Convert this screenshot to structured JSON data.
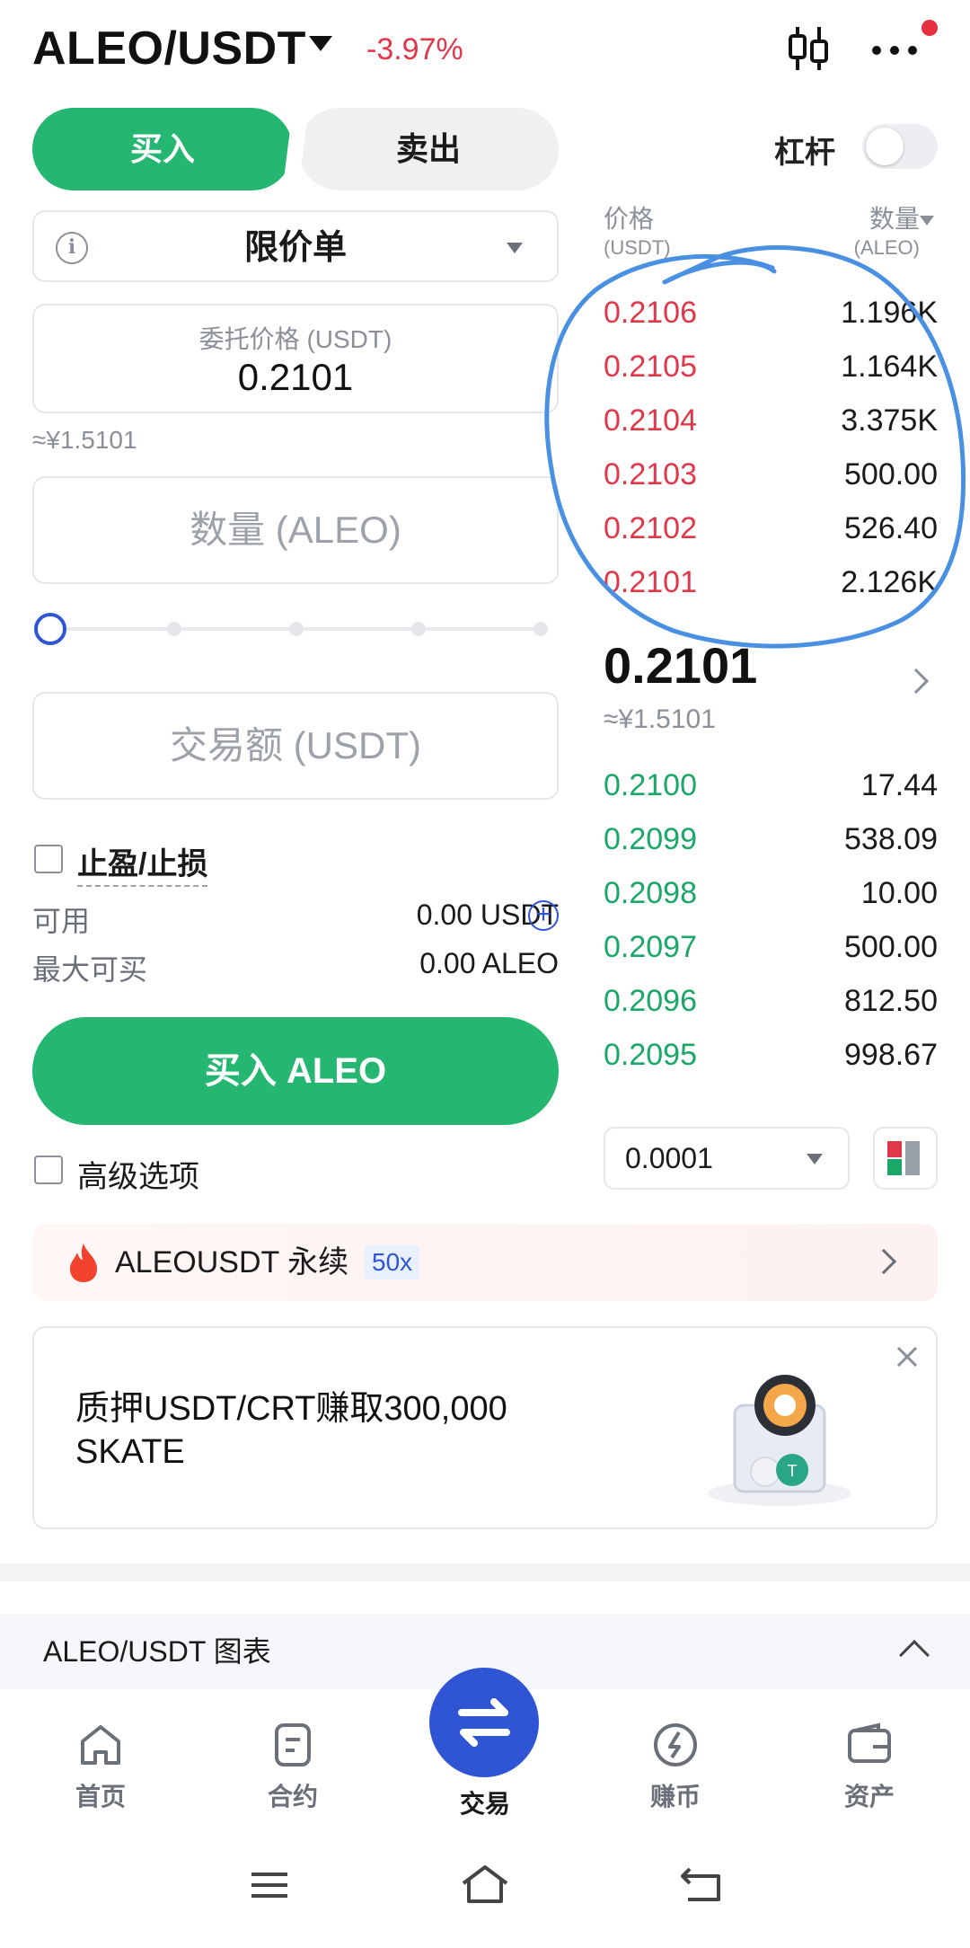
{
  "header": {
    "pair": "ALEO/USDT",
    "change": "-3.97%"
  },
  "tabs": {
    "buy": "买入",
    "sell": "卖出"
  },
  "leverage": {
    "label": "杠杆"
  },
  "order_form": {
    "order_type": "限价单",
    "price_caption": "委托价格 (USDT)",
    "price_value": "0.2101",
    "price_cny": "≈¥1.5101",
    "quantity_placeholder": "数量 (ALEO)",
    "amount_placeholder": "交易额 (USDT)",
    "tp_sl_label": "止盈/止损",
    "available_label": "可用",
    "available_value": "0.00 USDT",
    "max_buy_label": "最大可买",
    "max_buy_value": "0.00 ALEO",
    "buy_button": "买入 ALEO",
    "advanced_label": "高级选项",
    "slider_percent": 0
  },
  "order_book": {
    "price_header": "价格",
    "price_unit": "(USDT)",
    "qty_header": "数量",
    "qty_unit": "(ALEO)",
    "asks": [
      {
        "price": "0.2106",
        "qty": "1.196K"
      },
      {
        "price": "0.2105",
        "qty": "1.164K"
      },
      {
        "price": "0.2104",
        "qty": "3.375K"
      },
      {
        "price": "0.2103",
        "qty": "500.00"
      },
      {
        "price": "0.2102",
        "qty": "526.40"
      },
      {
        "price": "0.2101",
        "qty": "2.126K"
      }
    ],
    "last_price": "0.2101",
    "last_price_cny": "≈¥1.5101",
    "bids": [
      {
        "price": "0.2100",
        "qty": "17.44"
      },
      {
        "price": "0.2099",
        "qty": "538.09"
      },
      {
        "price": "0.2098",
        "qty": "10.00"
      },
      {
        "price": "0.2097",
        "qty": "500.00"
      },
      {
        "price": "0.2096",
        "qty": "812.50"
      },
      {
        "price": "0.2095",
        "qty": "998.67"
      }
    ],
    "precision": "0.0001"
  },
  "perpetual_banner": {
    "label": "ALEOUSDT 永续",
    "leverage": "50x"
  },
  "promo": {
    "text": "质押USDT/CRT赚取300,000 SKATE"
  },
  "chart_section": {
    "label": "ALEO/USDT 图表"
  },
  "bottom_nav": {
    "items": [
      {
        "label": "首页",
        "icon": "home-icon"
      },
      {
        "label": "合约",
        "icon": "contract-icon"
      },
      {
        "label": "交易",
        "icon": "trade-swap-icon"
      },
      {
        "label": "赚币",
        "icon": "earn-icon"
      },
      {
        "label": "资产",
        "icon": "wallet-icon"
      }
    ]
  },
  "colors": {
    "buy_green": "#25b771",
    "ask_red": "#e0384b",
    "bid_green": "#1aa768",
    "accent_blue": "#2f55d4",
    "annotation_blue": "#4a90e2"
  }
}
